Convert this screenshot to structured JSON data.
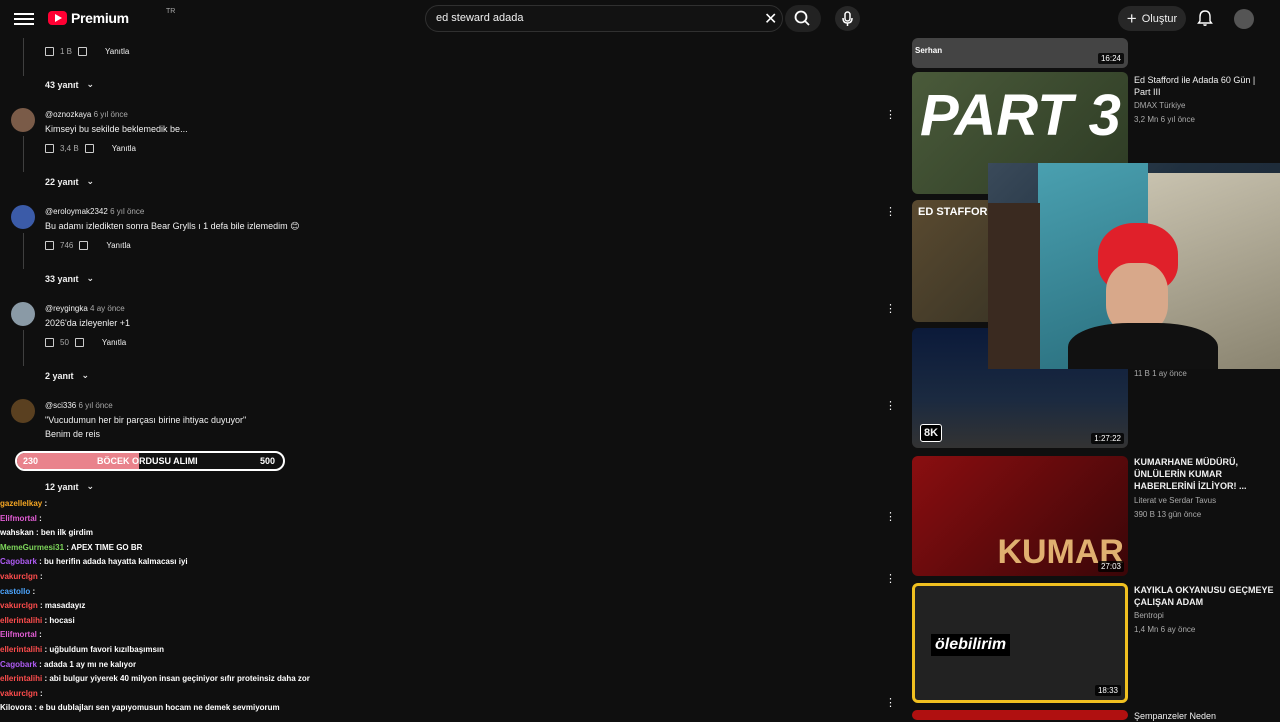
{
  "header": {
    "logo_text": "Premium",
    "logo_country": "TR",
    "search_value": "ed steward adada",
    "create_label": "Oluştur"
  },
  "comments": [
    {
      "likes": "1 B",
      "reply": "Yanıtla",
      "replies": "43 yanıt"
    },
    {
      "author": "@oznozkaya",
      "time": "6 yıl önce",
      "text": "Kimseyi bu sekilde beklemedik be...",
      "likes": "3,4 B",
      "reply": "Yanıtla",
      "replies": "22 yanıt"
    },
    {
      "author": "@eroloymak2342",
      "time": "6 yıl önce",
      "text": "Bu adamı izledikten sonra Bear Grylls ı 1 defa bile izlemedim 😊",
      "likes": "746",
      "reply": "Yanıtla",
      "replies": "33 yanıt"
    },
    {
      "author": "@reygingka",
      "time": "4 ay önce",
      "text": "2026'da izleyenler +1",
      "likes": "50",
      "reply": "Yanıtla",
      "replies": "2 yanıt"
    },
    {
      "author": "@sci336",
      "time": "6 yıl önce",
      "text": "\"Vucudumun her bir parçası birine ihtiyac duyuyor\"",
      "text2": "Benim de reis",
      "replies": "12 yanıt"
    }
  ],
  "progress": {
    "current": "230",
    "title": "BÖCEK ORDUSU ALIMI",
    "goal": "500",
    "fraction": 0.46
  },
  "chat": [
    {
      "user": "gazellelkay",
      "msg": ":",
      "color": "#f5a623"
    },
    {
      "user": "Elifmortal",
      "msg": ":",
      "color": "#e05cd3"
    },
    {
      "user": "wahskan",
      "msg": ": ben ilk girdim",
      "color": "#ffffff"
    },
    {
      "user": "MemeGurmesi31",
      "msg": ": APEX TIME GO BR",
      "color": "#7dd65a"
    },
    {
      "user": "Cagobark",
      "msg": ": bu herifin adada hayatta kalmacası iyi",
      "color": "#b05cf5"
    },
    {
      "user": "vakurclgn",
      "msg": ":",
      "color": "#ff4d4d"
    },
    {
      "user": "castollo",
      "msg": ":",
      "color": "#4da6ff"
    },
    {
      "user": "vakurclgn",
      "msg": ": masadayız",
      "color": "#ff4d4d"
    },
    {
      "user": "ellerintalihi",
      "msg": ": hocasi",
      "color": "#ff4d4d"
    },
    {
      "user": "Elifmortal",
      "msg": ":",
      "color": "#e05cd3"
    },
    {
      "user": "ellerintalihi",
      "msg": ": uğbuldum favori kızılbaşımsın",
      "color": "#ff4d4d"
    },
    {
      "user": "Cagobark",
      "msg": ": adada 1 ay mı ne kalıyor",
      "color": "#b05cf5"
    },
    {
      "user": "ellerintalihi",
      "msg": ": abi bulgur yiyerek 40 milyon insan geçiniyor sıfır proteinsiz daha zor",
      "color": "#ff4d4d"
    },
    {
      "user": "vakurclgn",
      "msg": ":",
      "color": "#ff4d4d"
    },
    {
      "user": "Kilovora",
      "msg": ": e bu dublajları sen yapıyomusun hocam ne demek sevmiyorum",
      "color": "#ffffff"
    }
  ],
  "sidebar": [
    {
      "duration": "16:24",
      "thumb_text": "Serhan"
    },
    {
      "title": "Ed Stafford ile Adada 60 Gün | Part III",
      "channel": "DMAX Türkiye",
      "stats": "3,2 Mn  6 yıl önce",
      "thumb_text": "PART 3"
    },
    {
      "thumb_text": "ED STAFFORD"
    },
    {
      "duration": "1:27:22",
      "stats": "11 B  1 ay önce",
      "badge": "8K"
    },
    {
      "title": "KUMARHANE MÜDÜRÜ, ÜNLÜLERİN KUMAR HABERLERİNİ İZLİYOR! ...",
      "channel": "Literat ve Serdar Tavus",
      "stats": "390 B  13 gün önce",
      "duration": "27:03",
      "thumb_text": "KUMAR"
    },
    {
      "title": "KAYIKLA OKYANUSU GEÇMEYE ÇALIŞAN ADAM",
      "channel": "Bentropi",
      "stats": "1,4 Mn  6 ay önce",
      "duration": "18:33",
      "thumb_text": "ölebilirim"
    },
    {
      "title": "Şempanzeler Neden"
    }
  ]
}
